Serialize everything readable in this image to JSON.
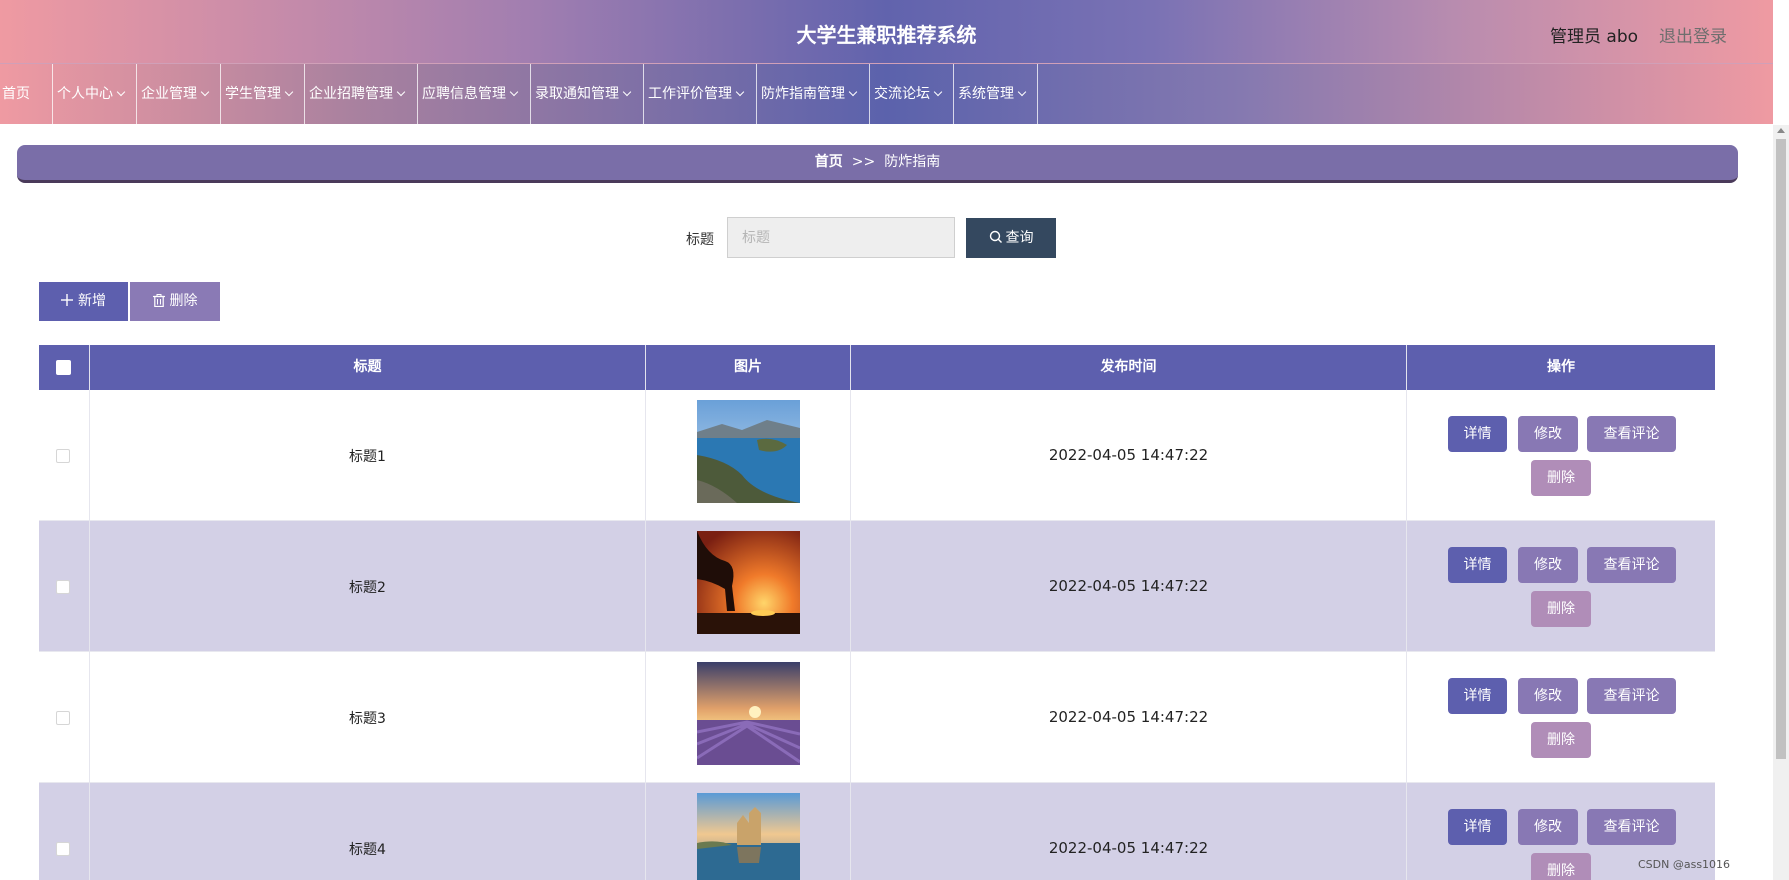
{
  "header": {
    "title": "大学生兼职推荐系统",
    "user": "管理员 abo",
    "logout": "退出登录"
  },
  "nav": {
    "items": [
      {
        "label": "首页",
        "has_dropdown": false
      },
      {
        "label": "个人中心",
        "has_dropdown": true
      },
      {
        "label": "企业管理",
        "has_dropdown": true
      },
      {
        "label": "学生管理",
        "has_dropdown": true
      },
      {
        "label": "企业招聘管理",
        "has_dropdown": true
      },
      {
        "label": "应聘信息管理",
        "has_dropdown": true
      },
      {
        "label": "录取通知管理",
        "has_dropdown": true
      },
      {
        "label": "工作评价管理",
        "has_dropdown": true
      },
      {
        "label": "防炸指南管理",
        "has_dropdown": true
      },
      {
        "label": "交流论坛",
        "has_dropdown": true
      },
      {
        "label": "系统管理",
        "has_dropdown": true
      }
    ]
  },
  "breadcrumb": {
    "home": "首页",
    "separator": ">>",
    "current": "防炸指南"
  },
  "search": {
    "label": "标题",
    "placeholder": "标题",
    "value": "",
    "button": "查询"
  },
  "actions": {
    "add": "新增",
    "delete": "删除"
  },
  "table": {
    "columns": [
      "标题",
      "图片",
      "发布时间",
      "操作"
    ],
    "rows": [
      {
        "title": "标题1",
        "image": "lake-coastline-photo",
        "time": "2022-04-05 14:47:22"
      },
      {
        "title": "标题2",
        "image": "sunset-tree-photo",
        "time": "2022-04-05 14:47:22"
      },
      {
        "title": "标题3",
        "image": "lavender-field-photo",
        "time": "2022-04-05 14:47:22"
      },
      {
        "title": "标题4",
        "image": "castle-water-photo",
        "time": "2022-04-05 14:47:22"
      }
    ],
    "row_actions": {
      "detail": "详情",
      "edit": "修改",
      "comments": "查看评论",
      "delete": "删除"
    }
  },
  "watermark": "CSDN @ass1016",
  "colors": {
    "primary": "#5d5fae",
    "secondary": "#8878b4",
    "danger": "#b08db8",
    "search_button": "#34485f",
    "even_row": "#d3d0e6"
  }
}
